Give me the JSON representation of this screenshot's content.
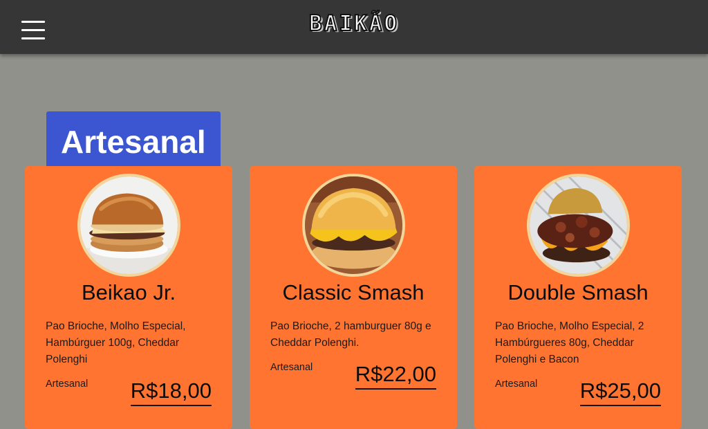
{
  "header": {
    "brand": "BAIKÃO",
    "menu_icon": "hamburger-menu-icon"
  },
  "section": {
    "title": "Artesanal"
  },
  "products": [
    {
      "name": "Beikao Jr.",
      "description": "Pao Brioche, Molho Especial, Hambúrguer 100g, Cheddar Polenghi",
      "category": "Artesanal",
      "price": "R$18,00"
    },
    {
      "name": "Classic Smash",
      "description": "Pao Brioche, 2 hamburguer 80g e Cheddar Polenghi.",
      "category": "Artesanal",
      "price": "R$22,00"
    },
    {
      "name": "Double Smash",
      "description": "Pao Brioche, Molho Especial, 2 Hambúrgueres 80g, Cheddar Polenghi e Bacon",
      "category": "Artesanal",
      "price": "R$25,00"
    }
  ],
  "colors": {
    "topbar": "#363636",
    "background": "#90918a",
    "section_badge": "#3c56d2",
    "card": "#ff7430",
    "photo_ring": "#f2d59a"
  }
}
